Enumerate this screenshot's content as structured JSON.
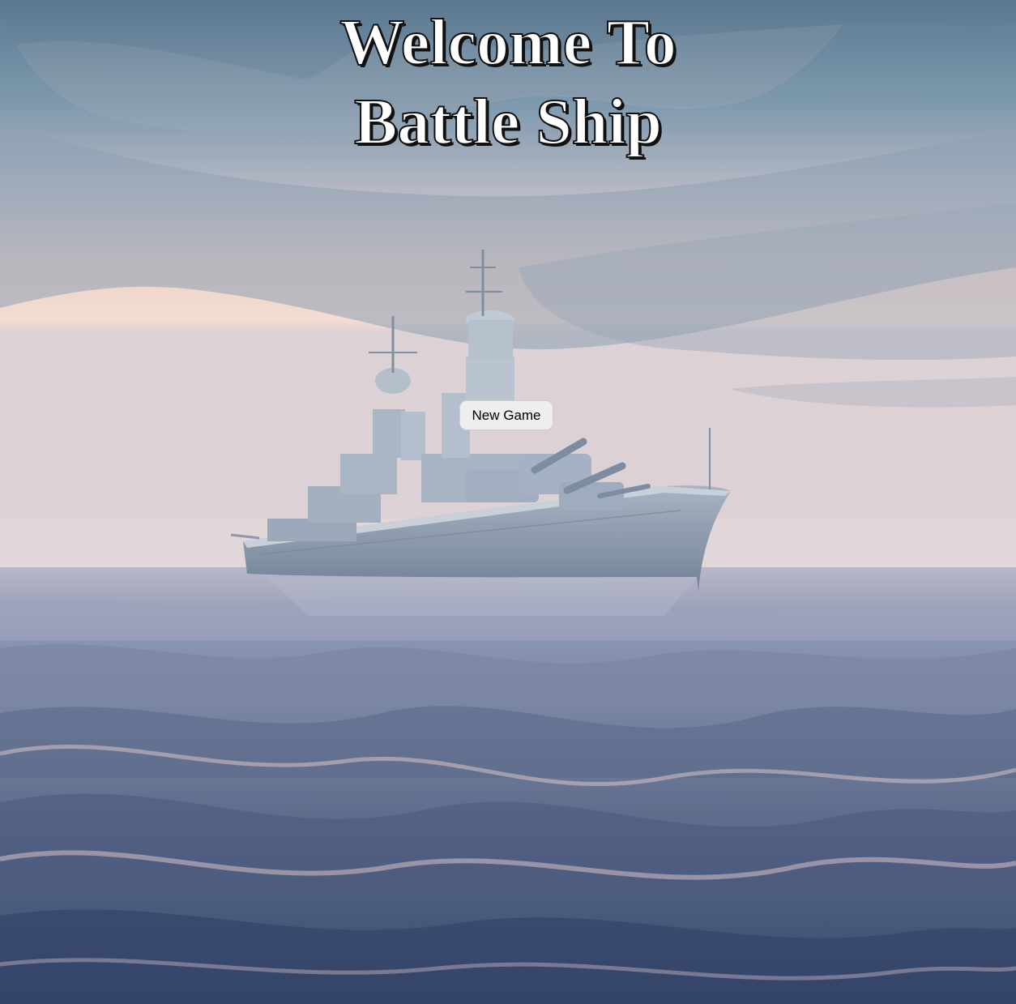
{
  "title": {
    "line1": "Welcome To",
    "line2": "Battle Ship"
  },
  "menu": {
    "new_game_label": "New Game"
  },
  "background": {
    "scene": "battleship at sea under a pastel dawn sky",
    "colors": {
      "sky_top": "#5d7f96",
      "sky_glow": "#f3d8cc",
      "sea_light": "#a2a9c0",
      "sea_dark": "#2c3f5e",
      "ship_hull": "#8d9db0"
    }
  }
}
